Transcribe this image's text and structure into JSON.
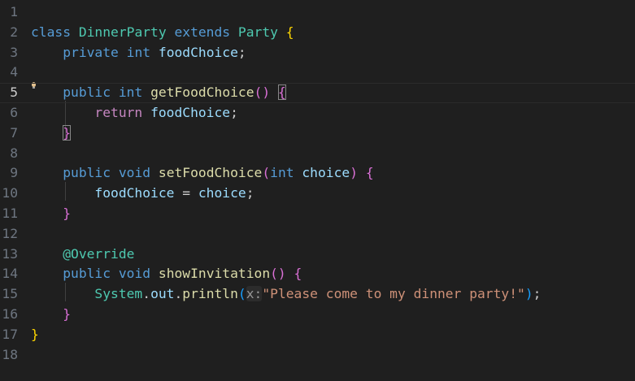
{
  "editor": {
    "current_line": 5,
    "lightbulb_icon": "lightbulb-icon",
    "colors": {
      "background": "#1f1f1f",
      "keyword": "#569cd6",
      "control_keyword": "#c586c0",
      "type": "#4ec9b0",
      "function": "#dcdcaa",
      "variable": "#9cdcfe",
      "string": "#ce9178",
      "bracket_level_1": "#ffd700",
      "bracket_level_2": "#da70d6",
      "bracket_level_3": "#179fff",
      "line_number": "#6e7681"
    },
    "lines": [
      {
        "n": "1",
        "tokens": []
      },
      {
        "n": "2",
        "tokens": [
          {
            "t": "class",
            "c": "kw"
          },
          {
            "t": " ",
            "c": "txt"
          },
          {
            "t": "DinnerParty",
            "c": "cls"
          },
          {
            "t": " ",
            "c": "txt"
          },
          {
            "t": "extends",
            "c": "kw"
          },
          {
            "t": " ",
            "c": "txt"
          },
          {
            "t": "Party",
            "c": "cls"
          },
          {
            "t": " ",
            "c": "txt"
          },
          {
            "t": "{",
            "c": "b1"
          }
        ]
      },
      {
        "n": "3",
        "tokens": [
          {
            "t": "    ",
            "c": "txt"
          },
          {
            "t": "private",
            "c": "kw"
          },
          {
            "t": " ",
            "c": "txt"
          },
          {
            "t": "int",
            "c": "kw"
          },
          {
            "t": " ",
            "c": "txt"
          },
          {
            "t": "foodChoice",
            "c": "var"
          },
          {
            "t": ";",
            "c": "txt"
          }
        ]
      },
      {
        "n": "4",
        "tokens": []
      },
      {
        "n": "5",
        "tokens": [
          {
            "t": "    ",
            "c": "txt"
          },
          {
            "t": "public",
            "c": "kw"
          },
          {
            "t": " ",
            "c": "txt"
          },
          {
            "t": "int",
            "c": "kw"
          },
          {
            "t": " ",
            "c": "txt"
          },
          {
            "t": "getFoodChoice",
            "c": "fn"
          },
          {
            "t": "()",
            "c": "b2"
          },
          {
            "t": " ",
            "c": "txt"
          },
          {
            "t": "{",
            "c": "b2 bm"
          }
        ]
      },
      {
        "n": "6",
        "tokens": [
          {
            "t": "        ",
            "c": "txt"
          },
          {
            "t": "return",
            "c": "ctl"
          },
          {
            "t": " ",
            "c": "txt"
          },
          {
            "t": "foodChoice",
            "c": "var"
          },
          {
            "t": ";",
            "c": "txt"
          }
        ]
      },
      {
        "n": "7",
        "tokens": [
          {
            "t": "    ",
            "c": "txt"
          },
          {
            "t": "}",
            "c": "b2 bm"
          }
        ]
      },
      {
        "n": "8",
        "tokens": []
      },
      {
        "n": "9",
        "tokens": [
          {
            "t": "    ",
            "c": "txt"
          },
          {
            "t": "public",
            "c": "kw"
          },
          {
            "t": " ",
            "c": "txt"
          },
          {
            "t": "void",
            "c": "kw"
          },
          {
            "t": " ",
            "c": "txt"
          },
          {
            "t": "setFoodChoice",
            "c": "fn"
          },
          {
            "t": "(",
            "c": "b2"
          },
          {
            "t": "int",
            "c": "kw"
          },
          {
            "t": " ",
            "c": "txt"
          },
          {
            "t": "choice",
            "c": "var"
          },
          {
            "t": ")",
            "c": "b2"
          },
          {
            "t": " ",
            "c": "txt"
          },
          {
            "t": "{",
            "c": "b2"
          }
        ]
      },
      {
        "n": "10",
        "tokens": [
          {
            "t": "        ",
            "c": "txt"
          },
          {
            "t": "foodChoice",
            "c": "var"
          },
          {
            "t": " = ",
            "c": "txt"
          },
          {
            "t": "choice",
            "c": "var"
          },
          {
            "t": ";",
            "c": "txt"
          }
        ]
      },
      {
        "n": "11",
        "tokens": [
          {
            "t": "    ",
            "c": "txt"
          },
          {
            "t": "}",
            "c": "b2"
          }
        ]
      },
      {
        "n": "12",
        "tokens": []
      },
      {
        "n": "13",
        "tokens": [
          {
            "t": "    ",
            "c": "txt"
          },
          {
            "t": "@Override",
            "c": "ann"
          }
        ]
      },
      {
        "n": "14",
        "tokens": [
          {
            "t": "    ",
            "c": "txt"
          },
          {
            "t": "public",
            "c": "kw"
          },
          {
            "t": " ",
            "c": "txt"
          },
          {
            "t": "void",
            "c": "kw"
          },
          {
            "t": " ",
            "c": "txt"
          },
          {
            "t": "showInvitation",
            "c": "fn"
          },
          {
            "t": "()",
            "c": "b2"
          },
          {
            "t": " ",
            "c": "txt"
          },
          {
            "t": "{",
            "c": "b2"
          }
        ]
      },
      {
        "n": "15",
        "tokens": [
          {
            "t": "        ",
            "c": "txt"
          },
          {
            "t": "System",
            "c": "cls"
          },
          {
            "t": ".",
            "c": "txt"
          },
          {
            "t": "out",
            "c": "var"
          },
          {
            "t": ".",
            "c": "txt"
          },
          {
            "t": "println",
            "c": "fn"
          },
          {
            "t": "(",
            "c": "b3"
          },
          {
            "t": "x:",
            "c": "hint"
          },
          {
            "t": "\"Please come to my dinner party!\"",
            "c": "str"
          },
          {
            "t": ")",
            "c": "b3"
          },
          {
            "t": ";",
            "c": "txt"
          }
        ]
      },
      {
        "n": "16",
        "tokens": [
          {
            "t": "    ",
            "c": "txt"
          },
          {
            "t": "}",
            "c": "b2"
          }
        ]
      },
      {
        "n": "17",
        "tokens": [
          {
            "t": "}",
            "c": "b1"
          }
        ]
      },
      {
        "n": "18",
        "tokens": []
      }
    ]
  }
}
